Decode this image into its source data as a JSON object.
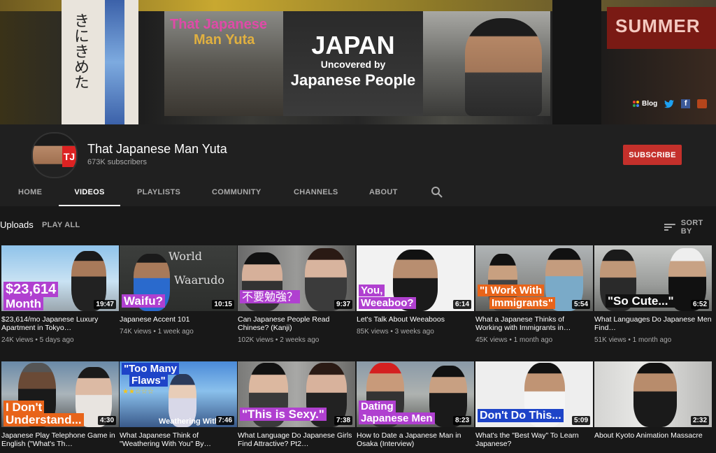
{
  "banner": {
    "brand_line1": "That Japanese",
    "brand_line2": "Man Yuta",
    "headline": "JAPAN",
    "subheadline": "Uncovered by",
    "tagline": "Japanese People",
    "sign_text": "きにきめた",
    "right_sign": "SUMMER",
    "links": {
      "blog_label": "Blog",
      "twitter_icon": "twitter-icon",
      "facebook_icon": "facebook-icon"
    }
  },
  "channel": {
    "name": "That Japanese Man Yuta",
    "subscribers": "673K subscribers",
    "subscribe_label": "SUBSCRIBE",
    "avatar_badge": "TJ"
  },
  "tabs": [
    {
      "label": "HOME"
    },
    {
      "label": "VIDEOS"
    },
    {
      "label": "PLAYLISTS"
    },
    {
      "label": "COMMUNITY"
    },
    {
      "label": "CHANNELS"
    },
    {
      "label": "ABOUT"
    }
  ],
  "active_tab": "VIDEOS",
  "uploads": {
    "label": "Uploads",
    "play_all": "PLAY ALL",
    "sort_by": "SORT BY"
  },
  "colors": {
    "background": "#181818",
    "header": "#202020",
    "subscribe": "#c4302b",
    "caption_purple": "#b040d0",
    "caption_orange": "#e8641a",
    "caption_blue": "#1e44c8"
  },
  "videos": [
    {
      "caption": "$23,614 Month",
      "caption_line1": "$23,614",
      "caption_line2": "Month",
      "duration": "19:47",
      "title": "$23,614/mo Japanese Luxury Apartment in Tokyo…",
      "views": "24K views",
      "age": "5 days ago"
    },
    {
      "caption": "Waifu?",
      "caption_line1": "Waifu?",
      "caption_line2": "",
      "duration": "10:15",
      "title": "Japanese Accent 101",
      "views": "74K views",
      "age": "1 week ago",
      "board_line1": "World",
      "board_line2": "Waarudo"
    },
    {
      "caption": "不要勉強？",
      "caption_line1": "不要勉強？",
      "caption_line2": "",
      "duration": "9:37",
      "title": "Can Japanese People Read Chinese? (Kanji)",
      "views": "102K views",
      "age": "2 weeks ago"
    },
    {
      "caption": "You, Weeaboo?",
      "caption_line1": "You,",
      "caption_line2": "Weeaboo?",
      "duration": "6:14",
      "title": "Let's Talk About Weeaboos",
      "views": "85K views",
      "age": "3 weeks ago"
    },
    {
      "caption": "\"I Work With Immigrants\"",
      "caption_line1": "\"I Work With",
      "caption_line2": "Immigrants\"",
      "duration": "5:54",
      "title": "What a Japanese Thinks of Working with Immigrants in…",
      "views": "45K views",
      "age": "1 month ago"
    },
    {
      "caption": "\"So Cute...\"",
      "caption_line1": "\"So Cute...\"",
      "caption_line2": "",
      "duration": "6:52",
      "title": "What Languages Do Japanese Men Find…",
      "views": "51K views",
      "age": "1 month ago"
    },
    {
      "caption": "I Don't Understand...",
      "caption_line1": "I Don't",
      "caption_line2": "Understand...",
      "duration": "4:30",
      "title": "Japanese Play Telephone Game in English (\"What's Th…",
      "views": "",
      "age": ""
    },
    {
      "caption": "\"Too Many Flaws\"",
      "caption_line1": "\"Too Many",
      "caption_line2": "Flaws\"",
      "duration": "7:46",
      "title": "What Japanese Think of \"Weathering With You\" By…",
      "views": "",
      "age": "",
      "extra": "Weathering With"
    },
    {
      "caption": "\"This is Sexy.\"",
      "caption_line1": "\"This is Sexy.\"",
      "caption_line2": "",
      "duration": "7:38",
      "title": "What Language Do Japanese Girls Find Attractive? Pt2…",
      "views": "",
      "age": ""
    },
    {
      "caption": "Dating Japanese Men",
      "caption_line1": "Dating",
      "caption_line2": "Japanese Men",
      "duration": "8:23",
      "title": "How to Date a Japanese Man in Osaka (Interview)",
      "views": "",
      "age": ""
    },
    {
      "caption": "Don't Do This...",
      "caption_line1": "Don't Do This...",
      "caption_line2": "",
      "duration": "5:09",
      "title": "What's the \"Best Way\" To Learn Japanese?",
      "views": "",
      "age": ""
    },
    {
      "caption": "",
      "caption_line1": "",
      "caption_line2": "",
      "duration": "2:32",
      "title": "About Kyoto Animation Massacre",
      "views": "",
      "age": ""
    }
  ]
}
